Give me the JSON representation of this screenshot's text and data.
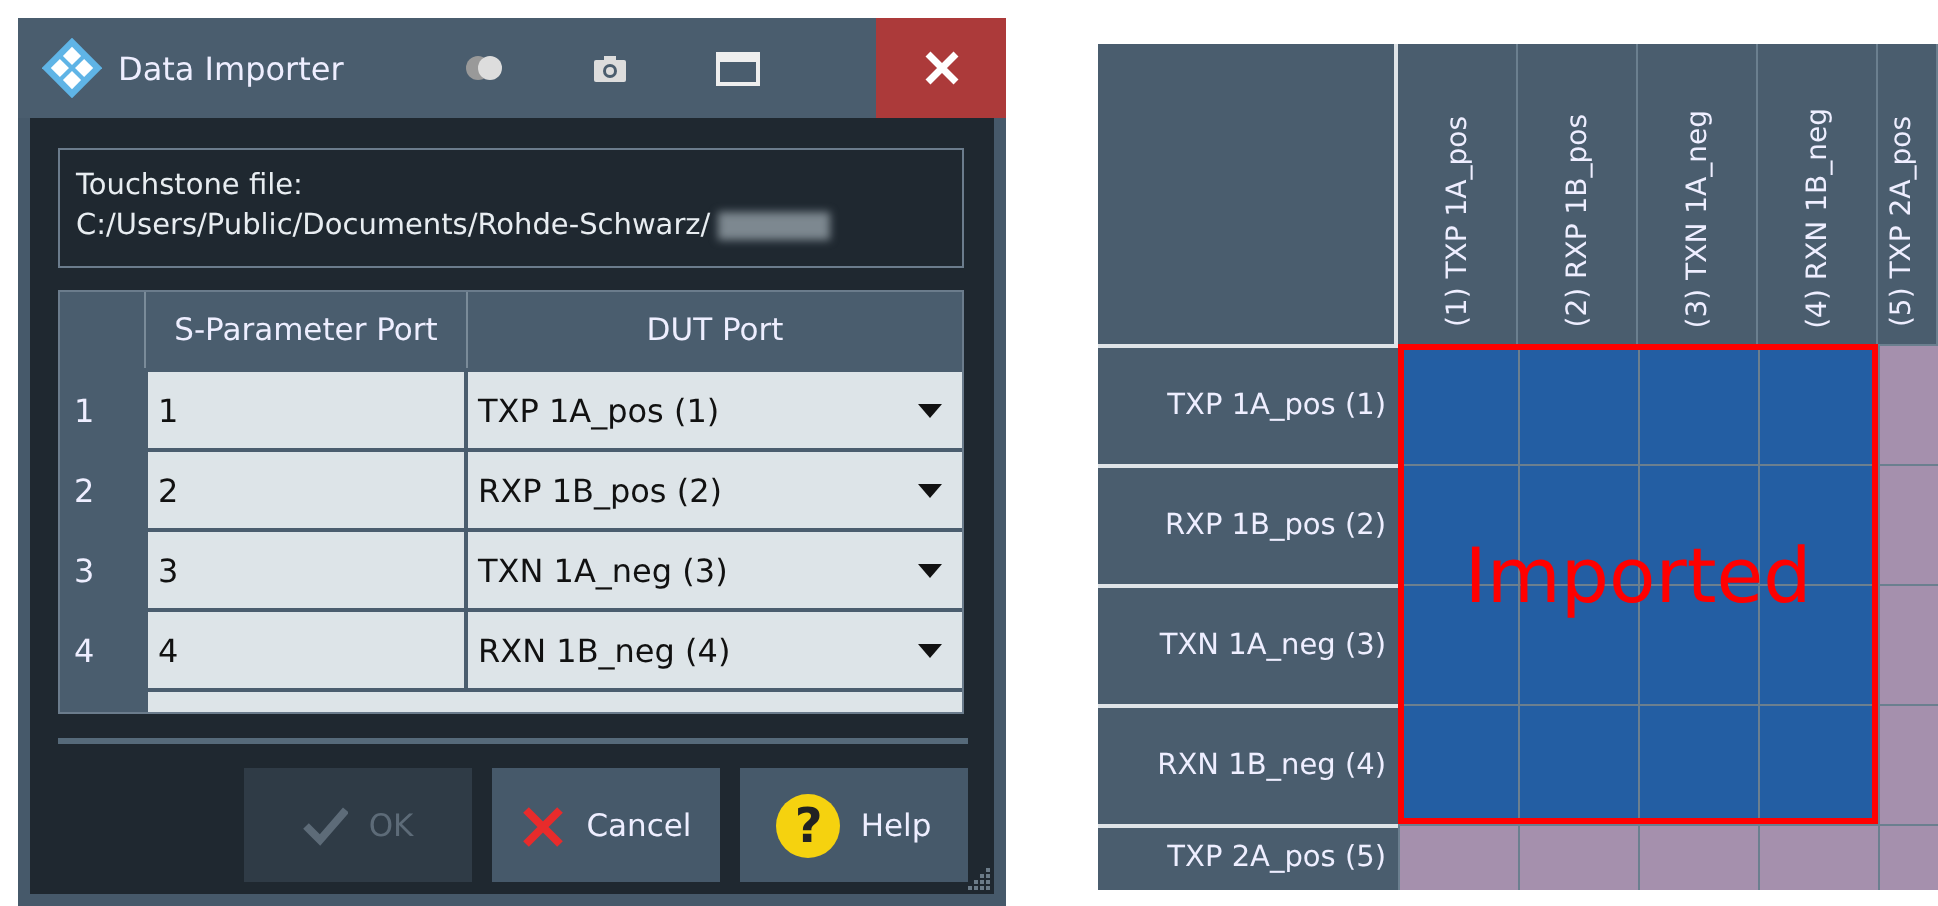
{
  "window": {
    "title": "Data Importer"
  },
  "file_group": {
    "label": "Touchstone file:",
    "path": "C:/Users/Public/Documents/Rohde-Schwarz/"
  },
  "table": {
    "columns": [
      "S-Parameter Port",
      "DUT Port"
    ],
    "rows": [
      {
        "index": "1",
        "port": "1",
        "dut_port": "TXP 1A_pos  (1)"
      },
      {
        "index": "2",
        "port": "2",
        "dut_port": "RXP 1B_pos  (2)"
      },
      {
        "index": "3",
        "port": "3",
        "dut_port": "TXN 1A_neg  (3)"
      },
      {
        "index": "4",
        "port": "4",
        "dut_port": "RXN 1B_neg  (4)"
      }
    ]
  },
  "buttons": [
    {
      "kind": "ok",
      "label": "OK",
      "disabled": true
    },
    {
      "kind": "cancel",
      "label": "Cancel",
      "disabled": false
    },
    {
      "kind": "help",
      "label": "Help",
      "icon_glyph": "?",
      "disabled": false
    }
  ],
  "matrix": {
    "columns": [
      "(1)  TXP 1A_pos",
      "(2)  RXP 1B_pos",
      "(3)  TXN 1A_neg",
      "(4)  RXN 1B_neg",
      "(5)  TXP 2A_pos"
    ],
    "rows": [
      {
        "label": "TXP 1A_pos  (1)",
        "cells": [
          true,
          true,
          true,
          true,
          false
        ]
      },
      {
        "label": "RXP 1B_pos  (2)",
        "cells": [
          true,
          true,
          true,
          true,
          false
        ]
      },
      {
        "label": "TXN 1A_neg  (3)",
        "cells": [
          true,
          true,
          true,
          true,
          false
        ]
      },
      {
        "label": "RXN 1B_neg  (4)",
        "cells": [
          true,
          true,
          true,
          true,
          false
        ]
      },
      {
        "label": "TXP 2A_pos  (5)",
        "cells": [
          false,
          false,
          false,
          false,
          false
        ]
      }
    ],
    "highlight_label": "Imported"
  }
}
